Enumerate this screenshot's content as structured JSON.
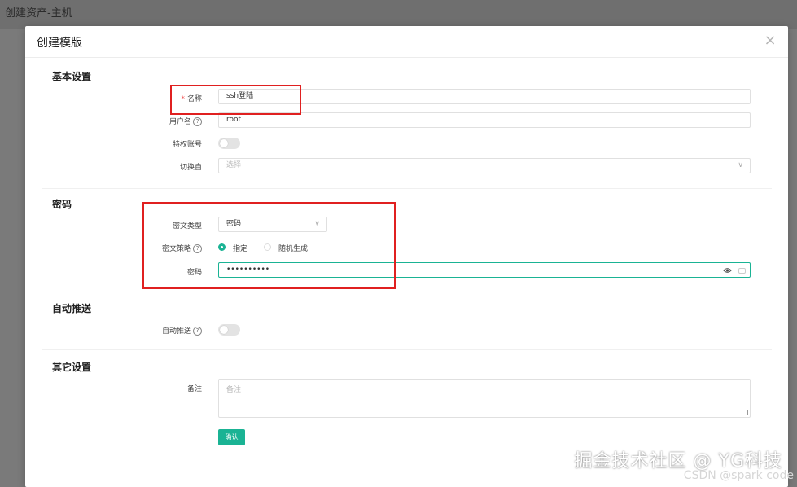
{
  "background": {
    "title": "创建资产-主机"
  },
  "modal": {
    "title": "创建模版",
    "close_icon": "close-icon"
  },
  "sections": {
    "basic": {
      "title": "基本设置",
      "name_label": "名称",
      "name_required_mark": "*",
      "name_value": "ssh登陆",
      "username_label": "用户名",
      "username_value": "root",
      "privileged_label": "特权账号",
      "privileged_on": false,
      "switch_from_label": "切换自",
      "switch_from_placeholder": "选择"
    },
    "password": {
      "title": "密码",
      "secret_type_label": "密文类型",
      "secret_type_value": "密码",
      "secret_strategy_label": "密文策略",
      "strategy_options": [
        "指定",
        "随机生成"
      ],
      "strategy_selected": "指定",
      "password_label": "密码",
      "password_value": "••••••••••"
    },
    "auto_push": {
      "title": "自动推送",
      "auto_push_label": "自动推送",
      "auto_push_on": false
    },
    "other": {
      "title": "其它设置",
      "comment_label": "备注",
      "comment_placeholder": "备注"
    }
  },
  "actions": {
    "confirm_label": "确认"
  },
  "colors": {
    "accent": "#1ab394",
    "highlight": "#e02020",
    "required": "#f05a5a"
  },
  "watermark": {
    "main": "掘金技术社区 @ YG科技",
    "secondary": "CSDN @spark code"
  }
}
